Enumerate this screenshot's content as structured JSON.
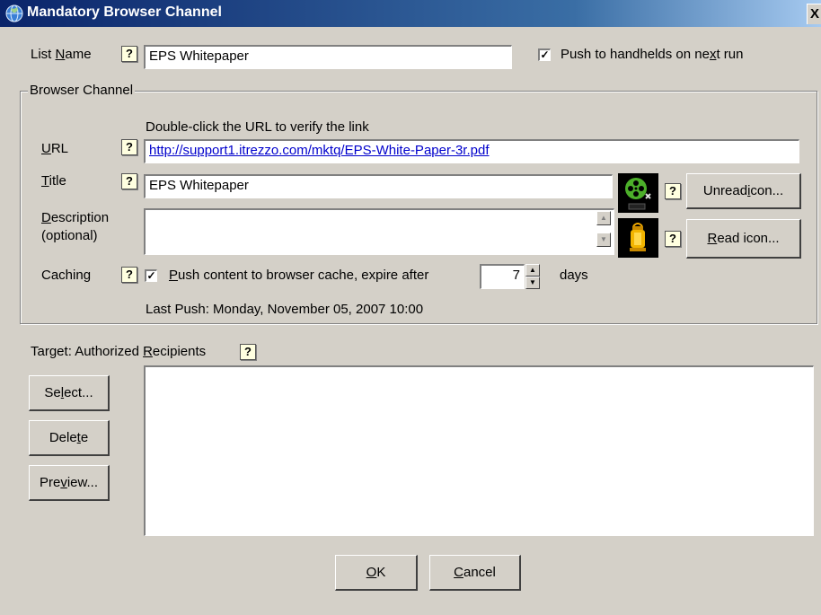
{
  "window": {
    "title": "Mandatory Browser Channel",
    "close_label": "X"
  },
  "list_name": {
    "label_pre": "List ",
    "label_key": "N",
    "label_post": "ame",
    "value": "EPS Whitepaper"
  },
  "push_handhelds": {
    "checked": true,
    "label_pre": "Push to handhelds on ne",
    "label_key": "x",
    "label_post": "t run"
  },
  "browser_channel": {
    "legend": "Browser Channel",
    "hint": "Double-click the URL to verify the link",
    "url": {
      "label_key": "U",
      "label_post": "RL",
      "value": "http://support1.itrezzo.com/mktq/EPS-White-Paper-3r.pdf"
    },
    "title": {
      "label_key": "T",
      "label_post": "itle",
      "value": "EPS Whitepaper"
    },
    "description": {
      "label_key": "D",
      "label_post": "escription",
      "label_line2": "(optional)",
      "value": ""
    },
    "unread_icon_button": {
      "label_pre": "Unread ",
      "label_key": "i",
      "label_post": "con..."
    },
    "read_icon_button": {
      "label_key": "R",
      "label_post": "ead icon..."
    },
    "caching": {
      "label": "Caching",
      "checked": true,
      "text_key": "P",
      "text_post": "ush content to browser cache, expire after",
      "days_value": "7",
      "days_label": "days"
    },
    "last_push": "Last Push: Monday, November 05, 2007 10:00"
  },
  "target": {
    "label_pre": "Target: Authorized ",
    "label_key": "R",
    "label_post": "ecipients"
  },
  "buttons": {
    "select": {
      "label_pre": "Se",
      "label_key": "l",
      "label_post": "ect..."
    },
    "delete": {
      "label_pre": "Dele",
      "label_key": "t",
      "label_post": "e"
    },
    "preview": {
      "label_pre": "Pre",
      "label_key": "v",
      "label_post": "iew..."
    },
    "ok": {
      "label_key": "O",
      "label_post": "K"
    },
    "cancel": {
      "label_key": "C",
      "label_post": "ancel"
    }
  },
  "help_glyph": "?",
  "checkmark_glyph": "✓",
  "icons": {
    "app": "globe-icon",
    "unread": "film-reel-icon",
    "read": "lantern-icon",
    "help": "help-icon"
  },
  "colors": {
    "titlebar": "#0a246a",
    "link": "#0000cc",
    "help_bg": "#ffffe0",
    "face": "#d4d0c8"
  }
}
